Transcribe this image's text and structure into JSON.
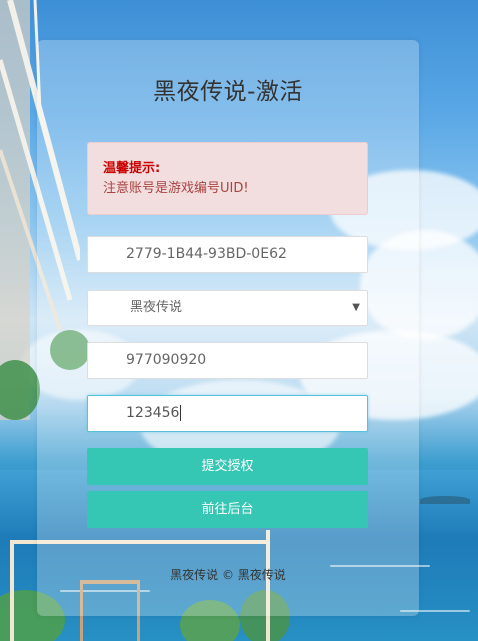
{
  "page": {
    "title": "黑夜传说-激活"
  },
  "alert": {
    "title": "温馨提示:",
    "message": "注意账号是游戏编号UID!"
  },
  "form": {
    "uid_value": "2779-1B44-93BD-0E62",
    "game_select_value": "黑夜传说",
    "account_value": "977090920",
    "password_value": "123456"
  },
  "buttons": {
    "submit_label": "提交授权",
    "backend_label": "前往后台"
  },
  "footer": {
    "text": "黑夜传说 © 黑夜传说"
  },
  "colors": {
    "accent": "#36c6b4",
    "alert_bg": "#f2dede",
    "alert_text": "#a94442"
  },
  "icons": {
    "select_arrow": "chevron-down-icon"
  }
}
